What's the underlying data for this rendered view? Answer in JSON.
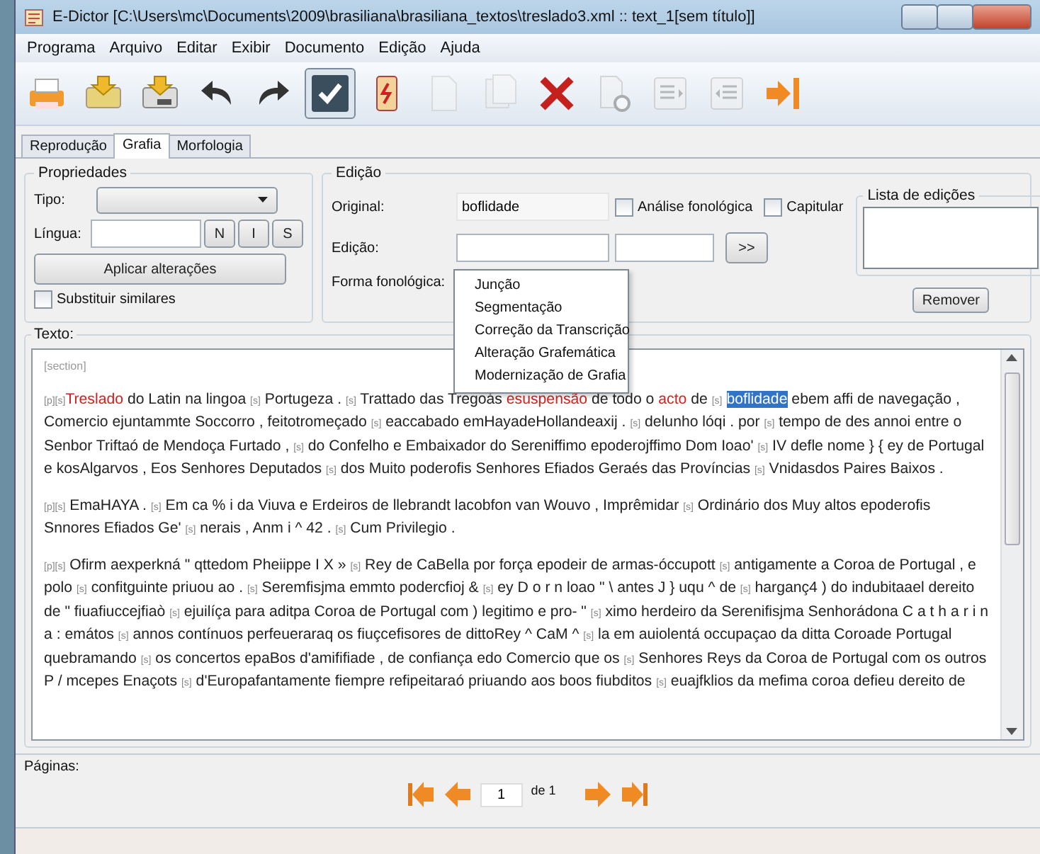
{
  "window": {
    "title": "E-Dictor [C:\\Users\\mc\\Documents\\2009\\brasiliana\\brasiliana_textos\\treslado3.xml :: text_1[sem título]]"
  },
  "menu": [
    "Programa",
    "Arquivo",
    "Editar",
    "Exibir",
    "Documento",
    "Edição",
    "Ajuda"
  ],
  "toolbar": [
    {
      "kind": "print",
      "disabled": false,
      "pressed": false
    },
    {
      "kind": "load",
      "disabled": false,
      "pressed": false
    },
    {
      "kind": "save",
      "disabled": false,
      "pressed": false
    },
    {
      "kind": "undo",
      "disabled": false,
      "pressed": false
    },
    {
      "kind": "redo",
      "disabled": false,
      "pressed": false
    },
    {
      "kind": "check",
      "disabled": false,
      "pressed": true
    },
    {
      "kind": "book",
      "disabled": false,
      "pressed": false
    },
    {
      "kind": "page",
      "disabled": true,
      "pressed": false
    },
    {
      "kind": "pages",
      "disabled": true,
      "pressed": false
    },
    {
      "kind": "delete",
      "disabled": false,
      "pressed": false
    },
    {
      "kind": "new-page",
      "disabled": true,
      "pressed": false
    },
    {
      "kind": "indent-left",
      "disabled": true,
      "pressed": false
    },
    {
      "kind": "indent-right",
      "disabled": true,
      "pressed": false
    },
    {
      "kind": "exit",
      "disabled": false,
      "pressed": false
    }
  ],
  "tabs": [
    {
      "label": "Reprodução",
      "selected": false
    },
    {
      "label": "Grafia",
      "selected": true
    },
    {
      "label": "Morfologia",
      "selected": false
    }
  ],
  "properties": {
    "title": "Propriedades",
    "type_label": "Tipo:",
    "language_label": "Língua:",
    "language_buttons": [
      "N",
      "I",
      "S"
    ],
    "apply_button": "Aplicar alterações",
    "replace_similar": {
      "label": "Substituir similares",
      "checked": false
    }
  },
  "edition": {
    "title": "Edição",
    "original_label": "Original:",
    "original_value": "boflidade",
    "options": [
      {
        "label": "Análise fonológica",
        "checked": false
      },
      {
        "label": "Capitular",
        "checked": false
      }
    ],
    "edition_label": "Edição:",
    "move_button": ">>",
    "phonological_label": "Forma fonológica:",
    "dropdown": [
      "Junção",
      "Segmentação",
      "Correção da Transcrição",
      "Alteração Grafemática",
      "Modernização de Grafia"
    ],
    "edits_list": {
      "title": "Lista de edições",
      "remove_button": "Remover"
    }
  },
  "text": {
    "label": "Texto:",
    "section_tag": "[section]",
    "paragraphs": [
      [
        {
          "kind": "marker",
          "text": "[p]"
        },
        {
          "kind": "marker",
          "text": "[s]"
        },
        {
          "kind": "red",
          "text": "Treslado"
        },
        {
          "kind": "plain",
          "text": " do Latin na lingoa "
        },
        {
          "kind": "marker",
          "text": "[s]"
        },
        {
          "kind": "plain",
          "text": " Portugeza . "
        },
        {
          "kind": "marker",
          "text": "[s]"
        },
        {
          "kind": "plain",
          "text": " Trattado das Tregoás "
        },
        {
          "kind": "red",
          "text": "esuspensão"
        },
        {
          "kind": "plain",
          "text": " de todo o "
        },
        {
          "kind": "red",
          "text": "acto"
        },
        {
          "kind": "plain",
          "text": " de "
        },
        {
          "kind": "marker",
          "text": "[s]"
        },
        {
          "kind": "highlight",
          "text": "boflidade"
        },
        {
          "kind": "plain",
          "text": " ebem affi de navegação , Comercio ejuntammte Soccorro , feitotromeçado "
        },
        {
          "kind": "marker",
          "text": "[s]"
        },
        {
          "kind": "plain",
          "text": " eaccabado emHayadeHollandeaxij . "
        },
        {
          "kind": "marker",
          "text": "[s]"
        },
        {
          "kind": "plain",
          "text": " delunho lóqi . por "
        },
        {
          "kind": "marker",
          "text": "[s]"
        },
        {
          "kind": "plain",
          "text": " tempo de des annoi entre o Senbor Triftaó de Mendoça Furtado , "
        },
        {
          "kind": "marker",
          "text": "[s]"
        },
        {
          "kind": "plain",
          "text": " do Confelho e Embaixador do Sereniffimo epoderojffimo Dom Ioao' "
        },
        {
          "kind": "marker",
          "text": "[s]"
        },
        {
          "kind": "plain",
          "text": " IV defle nome } { ey de Portugal e kosAlgarvos , Eos Senhores Deputados "
        },
        {
          "kind": "marker",
          "text": "[s]"
        },
        {
          "kind": "plain",
          "text": " dos Muito poderofis Senhores Efiados Geraés das Províncias "
        },
        {
          "kind": "marker",
          "text": "[s]"
        },
        {
          "kind": "plain",
          "text": " Vnidasdos Paires Baixos ."
        }
      ],
      [
        {
          "kind": "marker",
          "text": "[p]"
        },
        {
          "kind": "marker",
          "text": "[s]"
        },
        {
          "kind": "plain",
          "text": " EmaHAYA . "
        },
        {
          "kind": "marker",
          "text": "[s]"
        },
        {
          "kind": "plain",
          "text": " Em ca % i da Viuva e Erdeiros de llebrandt lacobfon van Wouvo , Imprêmidar "
        },
        {
          "kind": "marker",
          "text": "[s]"
        },
        {
          "kind": "plain",
          "text": " Ordinário dos Muy altos epoderofis Snnores Efiados Ge' "
        },
        {
          "kind": "marker",
          "text": "[s]"
        },
        {
          "kind": "plain",
          "text": " nerais , Anm i ^ 42 . "
        },
        {
          "kind": "marker",
          "text": "[s]"
        },
        {
          "kind": "plain",
          "text": " Cum Privilegio ."
        }
      ],
      [
        {
          "kind": "marker",
          "text": "[p]"
        },
        {
          "kind": "marker",
          "text": "[s]"
        },
        {
          "kind": "plain",
          "text": " Ofirm aexperkná \" qttedom Pheiippe I X » "
        },
        {
          "kind": "marker",
          "text": "[s]"
        },
        {
          "kind": "plain",
          "text": " Rey de CaBella por força epodeir de armas-óccupott "
        },
        {
          "kind": "marker",
          "text": "[s]"
        },
        {
          "kind": "plain",
          "text": " antigamente a Coroa de Portugal , e polo "
        },
        {
          "kind": "marker",
          "text": "[s]"
        },
        {
          "kind": "plain",
          "text": " confitguinte priuou ao . "
        },
        {
          "kind": "marker",
          "text": "[s]"
        },
        {
          "kind": "plain",
          "text": " Seremfisjma emmto podercfioj & "
        },
        {
          "kind": "marker",
          "text": "[s]"
        },
        {
          "kind": "plain",
          "text": " ey D o r n loao \" \\ antes J } uqu ^ de "
        },
        {
          "kind": "marker",
          "text": "[s]"
        },
        {
          "kind": "plain",
          "text": " harganç4 ) do indubitaael dereito de \" fiuafiuccejfiaò "
        },
        {
          "kind": "marker",
          "text": "[s]"
        },
        {
          "kind": "plain",
          "text": " ejuilíça para aditpa Coroa de Portugal com ) legitimo e pro- \" "
        },
        {
          "kind": "marker",
          "text": "[s]"
        },
        {
          "kind": "plain",
          "text": " ximo herdeiro da Serenifisjma Senhorádona C a t h a r i n a : emátos "
        },
        {
          "kind": "marker",
          "text": "[s]"
        },
        {
          "kind": "plain",
          "text": " annos contínuos perfeueraraq os fiuçcefisores de dittoRey ^ CaM ^ "
        },
        {
          "kind": "marker",
          "text": "[s]"
        },
        {
          "kind": "plain",
          "text": " la em auiolentá occupaçao da ditta Coroade Portugal quebramando "
        },
        {
          "kind": "marker",
          "text": "[s]"
        },
        {
          "kind": "plain",
          "text": " os concertos epaBos d'amififiade , de confiança edo Comercio que os "
        },
        {
          "kind": "marker",
          "text": "[s]"
        },
        {
          "kind": "plain",
          "text": " Senhores Reys da Coroa de Portugal com os outros P / mcepes Enaçots "
        },
        {
          "kind": "marker",
          "text": "[s]"
        },
        {
          "kind": "plain",
          "text": " d'Europafantamente fiempre refipeitaraó priuando aos boos fiubditos "
        },
        {
          "kind": "marker",
          "text": "[s]"
        },
        {
          "kind": "plain",
          "text": " euajfklios da mefima coroa defieu dereito de"
        }
      ]
    ]
  },
  "pages": {
    "label": "Páginas:",
    "page": "1",
    "of": "de 1"
  }
}
